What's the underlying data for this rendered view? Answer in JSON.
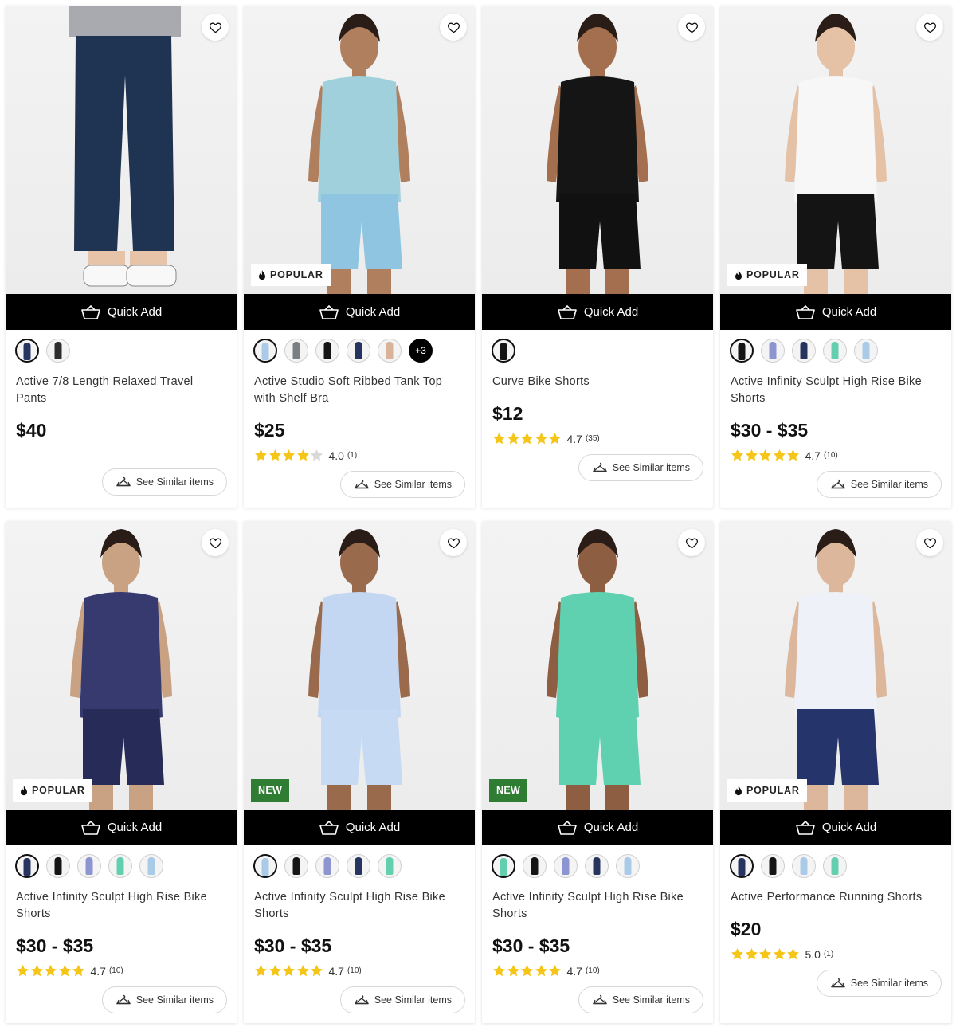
{
  "quick_add_label": "Quick Add",
  "see_similar_label": "See Similar items",
  "colors": {
    "star": "#f5c518",
    "new_badge": "#2e7d32",
    "quick_add_bg": "#000000"
  },
  "products": [
    {
      "name": "Active 7/8 Length Relaxed Travel Pants",
      "price": "$40",
      "badge": null,
      "rating": null,
      "swatches": [
        "navy",
        "charcoal"
      ],
      "more_swatches": null,
      "outfit": {
        "top": "#a9a9b0",
        "bottom": "#1f3352",
        "skin": "#e7c3a8",
        "shoes": "#ffffff"
      }
    },
    {
      "name": "Active Studio Soft Ribbed Tank Top with Shelf Bra",
      "price": "$25",
      "badge": "POPULAR",
      "rating": {
        "value": "4.0",
        "count": "(1)",
        "stars": 4
      },
      "swatches": [
        "light-blue",
        "gray",
        "black",
        "navy",
        "tan"
      ],
      "more_swatches": "+3",
      "outfit": {
        "top": "#9fd0dc",
        "bottom": "#8fc5e0",
        "skin": "#b07f5e",
        "shoes": null
      }
    },
    {
      "name": "Curve Bike Shorts",
      "price": "$12",
      "badge": null,
      "rating": {
        "value": "4.7",
        "count": "(35)",
        "stars": 5
      },
      "swatches": [
        "black"
      ],
      "more_swatches": null,
      "outfit": {
        "top": "#151515",
        "bottom": "#111111",
        "skin": "#a36f4e",
        "shoes": null
      }
    },
    {
      "name": "Active Infinity Sculpt High Rise Bike Shorts",
      "price": "$30 - $35",
      "badge": "POPULAR",
      "rating": {
        "value": "4.7",
        "count": "(10)",
        "stars": 5
      },
      "swatches": [
        "black",
        "periwinkle",
        "navy",
        "mint",
        "light-blue"
      ],
      "more_swatches": null,
      "outfit": {
        "top": "#f7f7f7",
        "bottom": "#141414",
        "skin": "#e5c1a5",
        "shoes": null
      }
    },
    {
      "name": "Active Infinity Sculpt High Rise Bike Shorts",
      "price": "$30 - $35",
      "badge": "POPULAR",
      "rating": {
        "value": "4.7",
        "count": "(10)",
        "stars": 5
      },
      "swatches": [
        "navy",
        "black",
        "periwinkle",
        "mint",
        "light-blue"
      ],
      "more_swatches": null,
      "outfit": {
        "top": "#363a6e",
        "bottom": "#262b58",
        "skin": "#c9a183",
        "shoes": "#1a1a1a"
      }
    },
    {
      "name": "Active Infinity Sculpt High Rise Bike Shorts",
      "price": "$30 - $35",
      "badge": "NEW",
      "rating": {
        "value": "4.7",
        "count": "(10)",
        "stars": 5
      },
      "swatches": [
        "light-blue",
        "black",
        "periwinkle",
        "navy",
        "mint"
      ],
      "more_swatches": null,
      "outfit": {
        "top": "#c3d7f3",
        "bottom": "#c7daf3",
        "skin": "#9a6a4c",
        "shoes": null
      }
    },
    {
      "name": "Active Infinity Sculpt High Rise Bike Shorts",
      "price": "$30 - $35",
      "badge": "NEW",
      "rating": {
        "value": "4.7",
        "count": "(10)",
        "stars": 5
      },
      "swatches": [
        "mint",
        "black",
        "periwinkle",
        "navy",
        "light-blue"
      ],
      "more_swatches": null,
      "outfit": {
        "top": "#5fd0b0",
        "bottom": "#5fd0b0",
        "skin": "#8e5e42",
        "shoes": null
      }
    },
    {
      "name": "Active Performance Running Shorts",
      "price": "$20",
      "badge": "POPULAR",
      "rating": {
        "value": "5.0",
        "count": "(1)",
        "stars": 5
      },
      "swatches": [
        "navy",
        "black",
        "light-blue",
        "mint"
      ],
      "more_swatches": null,
      "outfit": {
        "top": "#eef1f8",
        "bottom": "#25346a",
        "skin": "#ddb79b",
        "shoes": "#1a1a1a"
      }
    }
  ]
}
